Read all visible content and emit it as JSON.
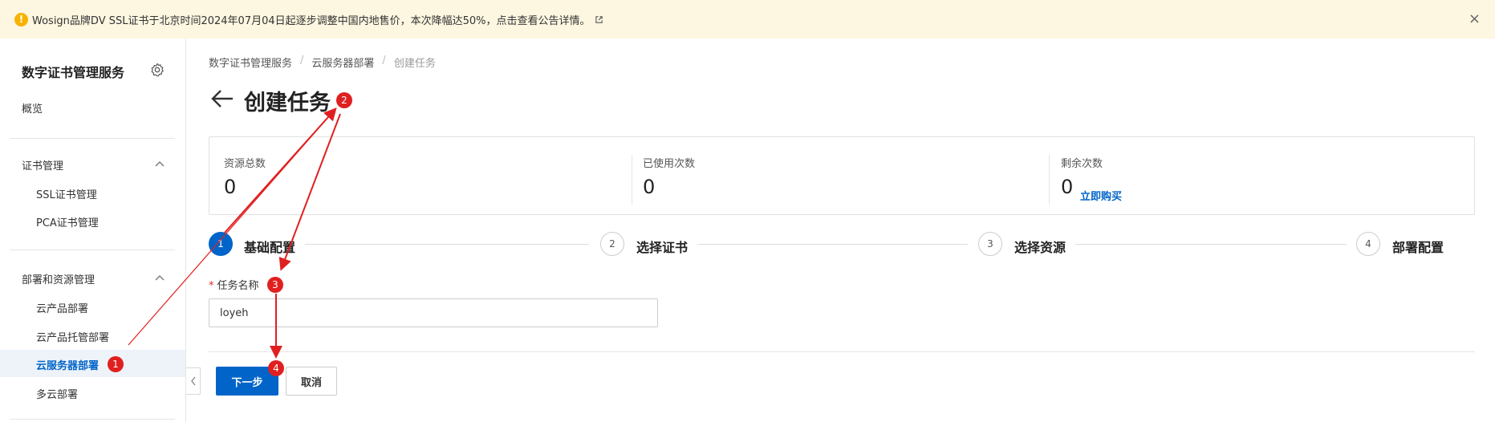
{
  "banner": {
    "text": "Wosign品牌DV SSL证书于北京时间2024年07月04日起逐步调整中国内地售价，本次降幅达50%，点击查看公告详情。",
    "warn_glyph": "!",
    "close_glyph": "×"
  },
  "sidebar": {
    "title": "数字证书管理服务",
    "overview": "概览",
    "groups": [
      {
        "label": "证书管理",
        "items": [
          "SSL证书管理",
          "PCA证书管理"
        ]
      },
      {
        "label": "部署和资源管理",
        "items": [
          "云产品部署",
          "云产品托管部署",
          "云服务器部署",
          "多云部署"
        ]
      }
    ],
    "active_item": "云服务器部署"
  },
  "breadcrumb": [
    "数字证书管理服务",
    "云服务器部署",
    "创建任务"
  ],
  "page_title": "创建任务",
  "stats": [
    {
      "label": "资源总数",
      "value": "0"
    },
    {
      "label": "已使用次数",
      "value": "0"
    },
    {
      "label": "剩余次数",
      "value": "0",
      "link": "立即购买"
    }
  ],
  "steps": [
    {
      "num": "1",
      "label": "基础配置",
      "active": true
    },
    {
      "num": "2",
      "label": "选择证书",
      "active": false
    },
    {
      "num": "3",
      "label": "选择资源",
      "active": false
    },
    {
      "num": "4",
      "label": "部署配置",
      "active": false
    }
  ],
  "form": {
    "task_name_label": "任务名称",
    "required_mark": "*",
    "task_name_value": "loyeh"
  },
  "buttons": {
    "next": "下一步",
    "cancel": "取消"
  },
  "annotations": [
    "1",
    "2",
    "3",
    "4"
  ],
  "colors": {
    "primary": "#0064c8",
    "annotation": "#e02020",
    "banner_bg": "#fdf6e0",
    "warn": "#f5b300"
  }
}
